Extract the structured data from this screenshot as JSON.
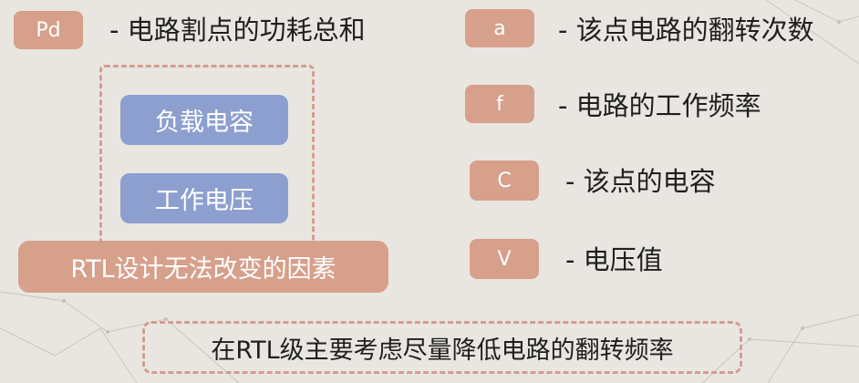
{
  "left_items": {
    "pd": {
      "tag": "Pd",
      "description": "- 电路割点的功耗总和"
    },
    "dashed_group": {
      "capacitance_label": "负载电容",
      "voltage_label": "工作电压",
      "footer_label": "RTL设计无法改变的因素"
    }
  },
  "right_items": [
    {
      "tag": "a",
      "description": "- 该点电路的翻转次数"
    },
    {
      "tag": "f",
      "description": "- 电路的工作频率"
    },
    {
      "tag": "C",
      "description": "- 该点的电容"
    },
    {
      "tag": "V",
      "description": "- 电压值"
    }
  ],
  "bottom_note": "在RTL级主要考虑尽量降低电路的翻转频率"
}
